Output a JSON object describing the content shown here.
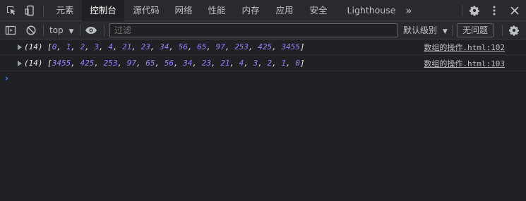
{
  "tabs": [
    {
      "label": "元素",
      "active": false
    },
    {
      "label": "控制台",
      "active": true
    },
    {
      "label": "源代码",
      "active": false
    },
    {
      "label": "网络",
      "active": false
    },
    {
      "label": "性能",
      "active": false
    },
    {
      "label": "内存",
      "active": false
    },
    {
      "label": "应用",
      "active": false
    },
    {
      "label": "安全",
      "active": false
    },
    {
      "label": "Lighthouse",
      "active": false
    }
  ],
  "more_tabs": "»",
  "toolbar": {
    "context": "top",
    "filter_placeholder": "过滤",
    "level": "默认级别",
    "issues": "无问题"
  },
  "messages": [
    {
      "count": "(14)",
      "array_open": "[",
      "values": [
        "0",
        "1",
        "2",
        "3",
        "4",
        "21",
        "23",
        "34",
        "56",
        "65",
        "97",
        "253",
        "425",
        "3455"
      ],
      "array_close": "]",
      "source": "数组的操作.html:102"
    },
    {
      "count": "(14)",
      "array_open": "[",
      "values": [
        "3455",
        "425",
        "253",
        "97",
        "65",
        "56",
        "34",
        "23",
        "21",
        "4",
        "3",
        "2",
        "1",
        "0"
      ],
      "array_close": "]",
      "source": "数组的操作.html:103"
    }
  ],
  "prompt_symbol": "›",
  "colors": {
    "accent": "#4d8dff",
    "number": "#9980ff",
    "background": "#202124",
    "toolbar": "#292a2d"
  }
}
